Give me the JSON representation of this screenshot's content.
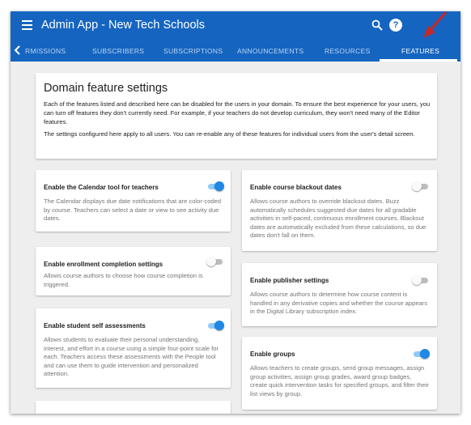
{
  "header": {
    "title": "Admin App - New Tech Schools",
    "menu_icon": "hamburger-menu-icon",
    "search_icon": "search-icon",
    "help_icon": "help-icon",
    "help_glyph": "?",
    "color": "#1565c0"
  },
  "tabs": {
    "items": [
      {
        "label": "RMISSIONS"
      },
      {
        "label": "SUBSCRIBERS"
      },
      {
        "label": "SUBSCRIPTIONS"
      },
      {
        "label": "ANNOUNCEMENTS"
      },
      {
        "label": "RESOURCES"
      },
      {
        "label": "FEATURES"
      }
    ],
    "active": "FEATURES"
  },
  "intro": {
    "title": "Domain feature settings",
    "paragraph1": "Each of the features listed and described here can be disabled for the users in your domain. To ensure the best experience for your users, you can turn off features they don't currently need. For example, if your teachers do not develop curriculum, they won't need many of the Editor features.",
    "paragraph2": "The settings configured here apply to all users. You can re-enable any of these features for individual users from the user's detail screen."
  },
  "features": {
    "calendar": {
      "title": "Enable the Calendar tool for teachers",
      "description": "The Calendar displays due date notifications that are color-coded by course. Teachers can select a date or view to see activity due dates.",
      "enabled": true
    },
    "enrollment": {
      "title": "Enable enrollment completion settings",
      "description": "Allows course authors to choose how course completion is triggered.",
      "enabled": false
    },
    "self_assessment": {
      "title": "Enable student self assessments",
      "description": "Allows students to evaluate their personal understanding, interest, and effort in a course using a simple four-point scale for each. Teachers access these assessments with the People tool and can use them to guide intervention and personalized attention.",
      "enabled": true
    },
    "blackout": {
      "title": "Enable course blackout dates",
      "description": "Allows course authors to override blackout dates. Buzz automatically schedules suggested due dates for all gradable activities in self-paced, continuous enrollment courses. Blackout dates are automatically excluded from these calculations, so due dates don't fall on them.",
      "enabled": false
    },
    "publisher": {
      "title": "Enable publisher settings",
      "description": "Allows course authors to determine how course content is handled in any derivative copies and whether the course appears in the Digital Library subscription index.",
      "enabled": false
    },
    "groups": {
      "title": "Enable groups",
      "description": "Allows teachers to create groups, send group messages, assign group activities, assign group grades, award group badges, create quick intervention tasks for specified groups, and filter their list views by group.",
      "enabled": true
    }
  },
  "annotation": {
    "color": "#c62828"
  }
}
